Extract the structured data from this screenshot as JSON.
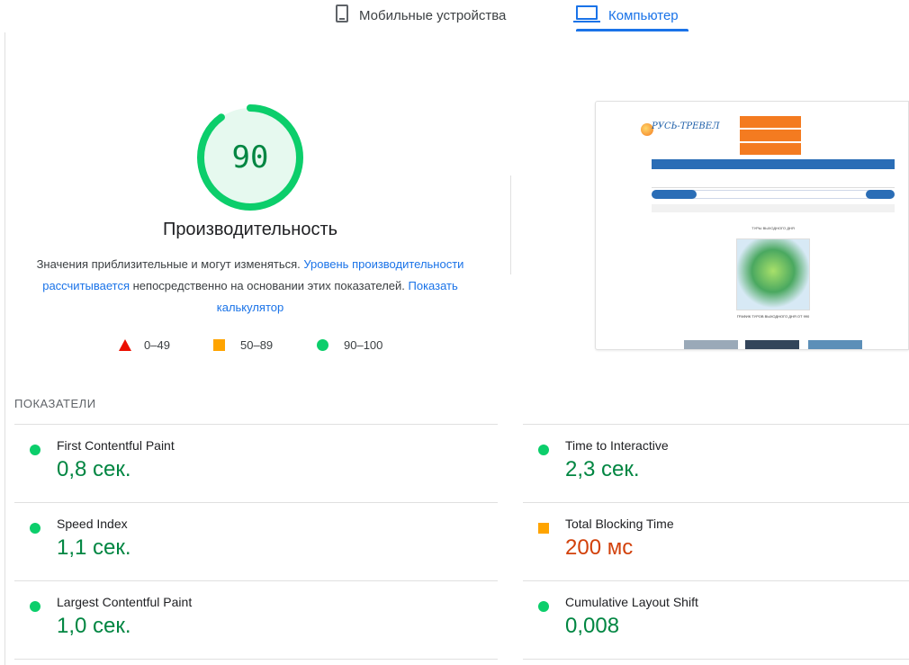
{
  "tabs": {
    "mobile": {
      "label": "Мобильные устройства",
      "icon": "phone-icon"
    },
    "desktop": {
      "label": "Компьютер",
      "icon": "laptop-icon",
      "selected": true
    }
  },
  "performance": {
    "score": "90",
    "score_fraction": 0.9,
    "title": "Производительность",
    "desc_1": "Значения приблизительные и могут изменяться. ",
    "link_1": "Уровень производительности рассчитывается",
    "desc_2": " непосредственно на основании этих показателей. ",
    "link_2": "Показать калькулятор",
    "colors": {
      "gauge": "#0cce6b",
      "gauge_bg": "#e6f9ef",
      "score": "#018642"
    }
  },
  "legend": {
    "fail": "0–49",
    "average": "50–89",
    "pass": "90–100"
  },
  "metrics": {
    "title": "ПОКАЗАТЕЛИ",
    "fcp": {
      "name": "First Contentful Paint",
      "value": "0,8 сек.",
      "status": "pass"
    },
    "tti": {
      "name": "Time to Interactive",
      "value": "2,3 сек.",
      "status": "pass"
    },
    "si": {
      "name": "Speed Index",
      "value": "1,1 сек.",
      "status": "pass"
    },
    "tbt": {
      "name": "Total Blocking Time",
      "value": "200 мс",
      "status": "average"
    },
    "lcp": {
      "name": "Largest Contentful Paint",
      "value": "1,0 сек.",
      "status": "pass"
    },
    "cls": {
      "name": "Cumulative Layout Shift",
      "value": "0,008",
      "status": "pass"
    }
  },
  "thumbnail": {
    "logo": "РУСЬ-ТРЕВЕЛ",
    "section_title": "ТУРЫ ВЫХОДНОГО ДНЯ",
    "caption": "ГРАФИК ТУРОВ ВЫХОДНОГО ДНЯ ОТ 990"
  }
}
